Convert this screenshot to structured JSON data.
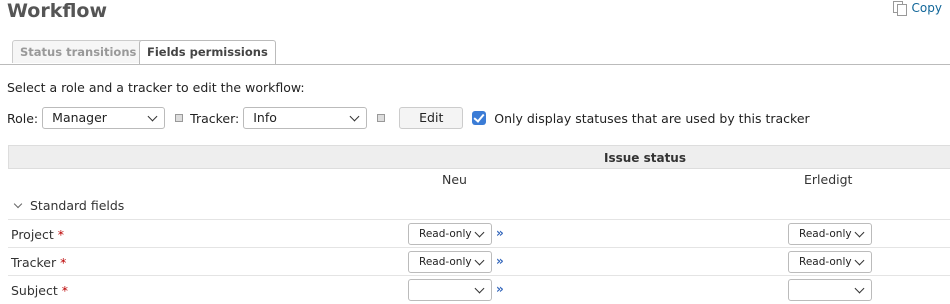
{
  "page": {
    "title": "Workflow",
    "copy_label": "Copy"
  },
  "tabs": [
    {
      "label": "Status transitions",
      "selected": false
    },
    {
      "label": "Fields permissions",
      "selected": true
    }
  ],
  "instruction": "Select a role and a tracker to edit the workflow:",
  "filter": {
    "role_label": "Role:",
    "role_value": "Manager",
    "tracker_label": "Tracker:",
    "tracker_value": "Info",
    "edit_label": "Edit",
    "only_used_label": "Only display statuses that are used by this tracker",
    "only_used_checked": true
  },
  "table": {
    "header": "Issue status",
    "columns": [
      "Neu",
      "Erledigt"
    ],
    "group": "Standard fields",
    "rows": [
      {
        "field": "Project",
        "required": "*",
        "values": [
          "Read-only",
          "Read-only"
        ]
      },
      {
        "field": "Tracker",
        "required": "*",
        "values": [
          "Read-only",
          "Read-only"
        ]
      },
      {
        "field": "Subject",
        "required": "*",
        "values": [
          "",
          ""
        ]
      }
    ],
    "apply_all_symbol": "»"
  },
  "colors": {
    "link": "#116699",
    "required": "#bb0000",
    "checkbox": "#3b7cd6",
    "header_bg": "#eeeeee"
  }
}
